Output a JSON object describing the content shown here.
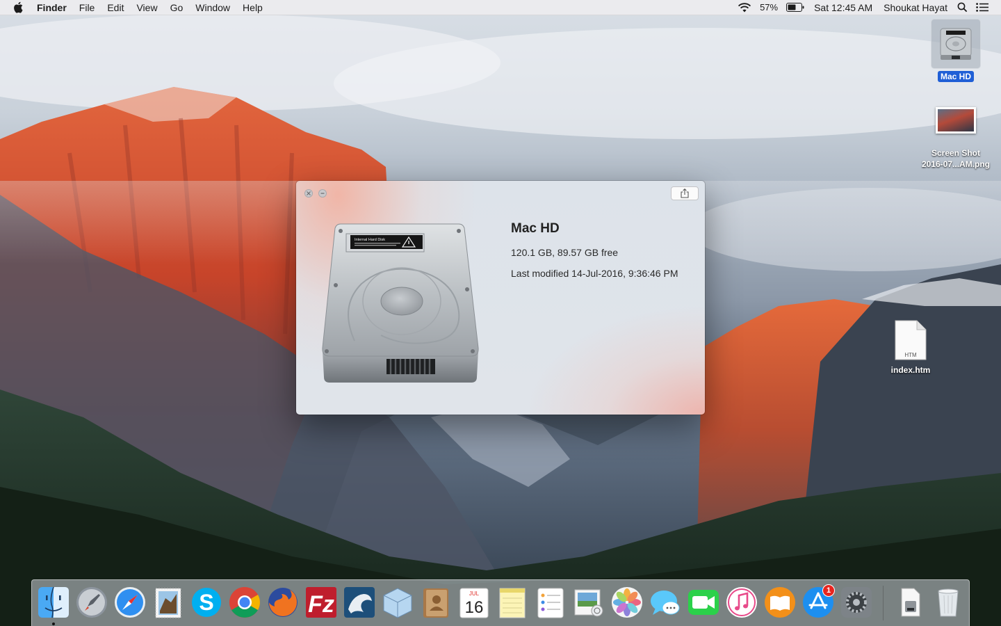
{
  "menubar": {
    "app_name": "Finder",
    "menus": [
      "File",
      "Edit",
      "View",
      "Go",
      "Window",
      "Help"
    ],
    "battery_percent": "57%",
    "clock": "Sat 12:45 AM",
    "user": "Shoukat Hayat",
    "icons": [
      "apple-icon",
      "wifi-icon",
      "battery-icon",
      "spotlight-icon",
      "notification-center-icon"
    ]
  },
  "desktop": {
    "icons": [
      {
        "name": "mac-hd",
        "label": "Mac HD",
        "selected": true
      },
      {
        "name": "screenshot",
        "label_line1": "Screen Shot",
        "label_line2": "2016-07...AM.png"
      },
      {
        "name": "index-htm",
        "label": "index.htm",
        "file_badge": "HTM"
      }
    ]
  },
  "info_window": {
    "title": "Mac HD",
    "capacity": "120.1 GB, 89.57 GB free",
    "modified": "Last modified 14-Jul-2016, 9:36:46 PM",
    "disk_label_title": "Internal Hard Disk"
  },
  "dock": {
    "calendar_month": "JUL",
    "calendar_day": "16",
    "app_store_badge": "1",
    "apps": [
      "Finder",
      "Launchpad",
      "Safari",
      "Mail",
      "Skype",
      "Google Chrome",
      "Firefox",
      "FileZilla",
      "MySQL Workbench",
      "Cube App",
      "Contacts",
      "Calendar",
      "Notes",
      "Reminders",
      "Preview",
      "Photos",
      "Messages",
      "FaceTime",
      "iTunes",
      "iBooks",
      "App Store",
      "System Preferences",
      "Documents",
      "Trash"
    ]
  },
  "colors": {
    "selection_blue": "#1f5fd6",
    "badge_red": "#e8251f",
    "menubar_bg": "#ececee"
  }
}
